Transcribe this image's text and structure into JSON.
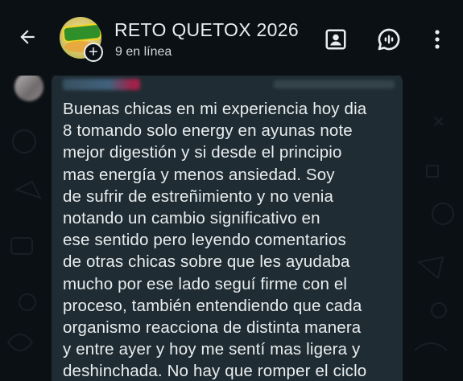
{
  "header": {
    "title": "RETO QUETOX 2026",
    "subtitle": "9 en línea",
    "icons": {
      "back": "arrow-left-icon",
      "avatar_badge": "plus-icon",
      "contacts": "contact-card-icon",
      "voice": "voice-chat-icon",
      "menu": "more-vert-icon"
    }
  },
  "chat": {
    "message": {
      "text": "Buenas chicas en mi experiencia hoy dia\n8 tomando solo energy en ayunas note\nmejor digestión y si desde el principio\nmas energía y menos ansiedad. Soy\nde sufrir de estreñimiento y no venia\nnotando un cambio significativo en\nese sentido pero leyendo comentarios\nde otras chicas sobre que les ayudaba\nmucho por ese lado seguí firme con el\nproceso, también entendiendo que cada\norganismo reacciona de distinta manera\ny entre ayer y hoy me sentí mas ligera y\ndeshinchada. No hay que romper el ciclo"
    }
  },
  "colors": {
    "background": "#0b1014",
    "bubble": "#1f2c33",
    "text": "#e9edef"
  }
}
